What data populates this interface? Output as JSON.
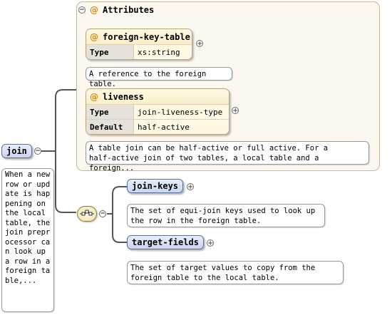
{
  "root": {
    "name": "join",
    "doc": "When a new row or update is happening on the local table, the join preprocessor can look up a row in a foreign table,..."
  },
  "attributes": {
    "label": "Attributes",
    "items": [
      {
        "name": "foreign-key-table",
        "rows": [
          {
            "key": "Type",
            "value": "xs:string"
          }
        ],
        "doc": "A reference to the foreign table."
      },
      {
        "name": "liveness",
        "rows": [
          {
            "key": "Type",
            "value": "join-liveness-type"
          },
          {
            "key": "Default",
            "value": "half-active"
          }
        ],
        "doc_lines": [
          "A table join can be half-active or full active. For a",
          "half-active join of two tables, a local table and a foreign..."
        ]
      }
    ]
  },
  "children": [
    {
      "name": "join-keys",
      "doc_lines": [
        "The set of equi-join keys used to look up",
        "the row in the foreign table."
      ]
    },
    {
      "name": "target-fields",
      "doc_lines": [
        "The set of target values to copy from the",
        "foreign table to the local table."
      ]
    }
  ],
  "colors": {
    "element_fill": "#c9d4ee",
    "attribute_fill": "#fff8e3",
    "attribute_marker": "#d08a18",
    "group_fill": "#fcf7ef"
  }
}
